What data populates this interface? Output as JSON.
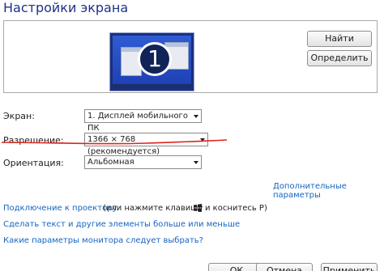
{
  "window": {
    "title": "Настройки экрана"
  },
  "preview": {
    "display_number": "1"
  },
  "buttons": {
    "find": "Найти",
    "identify": "Определить"
  },
  "fields": {
    "screen": {
      "label": "Экран:",
      "value": "1. Дисплей мобильного ПК"
    },
    "resolution": {
      "label": "Разрешение:",
      "value": "1366 × 768 (рекомендуется)"
    },
    "orientation": {
      "label": "Ориентация:",
      "value": "Альбомная"
    }
  },
  "links": {
    "advanced": "Дополнительные параметры",
    "projector": "Подключение к проектору",
    "projector_hint_before": "(или нажмите клавишу",
    "projector_hint_after": "и коснитесь Р)",
    "text_size": "Сделать текст и другие элементы больше или меньше",
    "which_params": "Какие параметры монитора следует выбрать?"
  },
  "footer": {
    "ok": "ОК",
    "cancel": "Отмена",
    "apply": "Применить"
  },
  "colors": {
    "link": "#1564c0",
    "title": "#1e3287",
    "underline": "#e0231c"
  }
}
